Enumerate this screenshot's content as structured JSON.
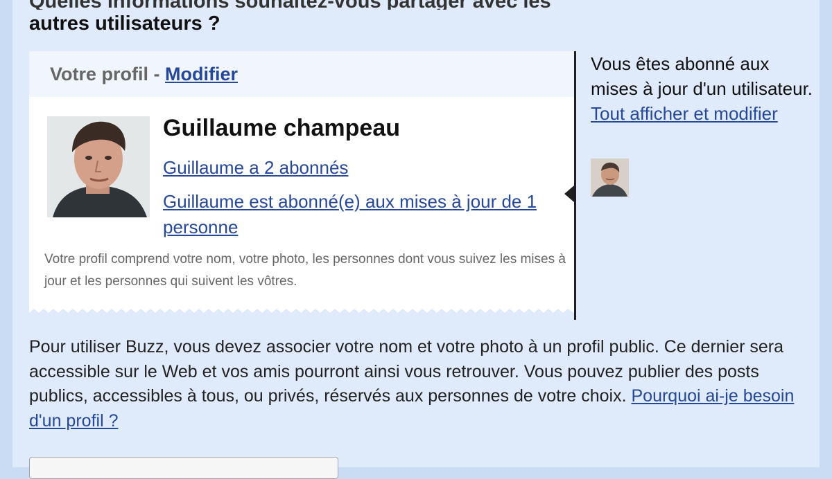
{
  "question": {
    "line1": "Quelles informations souhaitez-vous partager avec les",
    "line2": "autres utilisateurs ?"
  },
  "profile_card": {
    "header_label": "Votre profil - ",
    "edit_link": "Modifier",
    "name": "Guillaume champeau",
    "followers_link": "Guillaume a 2 abonnés",
    "following_link": "Guillaume est abonné(e) aux mises à jour de 1 personne",
    "description": "Votre profil comprend votre nom, votre photo, les personnes dont vous suivez les mises à jour et les personnes qui suivent les vôtres."
  },
  "sidebar": {
    "subscription_text": "Vous êtes abonné aux mises à jour d'un utilisateur.",
    "manage_link": "Tout afficher et modifier"
  },
  "explanation": {
    "text": "Pour utiliser Buzz, vous devez associer votre nom et votre photo à un profil public. Ce dernier sera accessible sur le Web et vos amis pourront ainsi vous retrouver. Vous pouvez publier des posts publics, accessibles à tous, ou privés, réservés aux personnes de votre choix. ",
    "why_link": "Pourquoi ai-je besoin d'un profil ?"
  },
  "colors": {
    "page_background": "#c9dcf4",
    "panel_background": "#dfeafa",
    "link": "#26489b",
    "card_header": "#f1f6fd"
  },
  "icons": {
    "profile_photo": "person-photo",
    "subscribed_user_photo": "person-photo"
  }
}
